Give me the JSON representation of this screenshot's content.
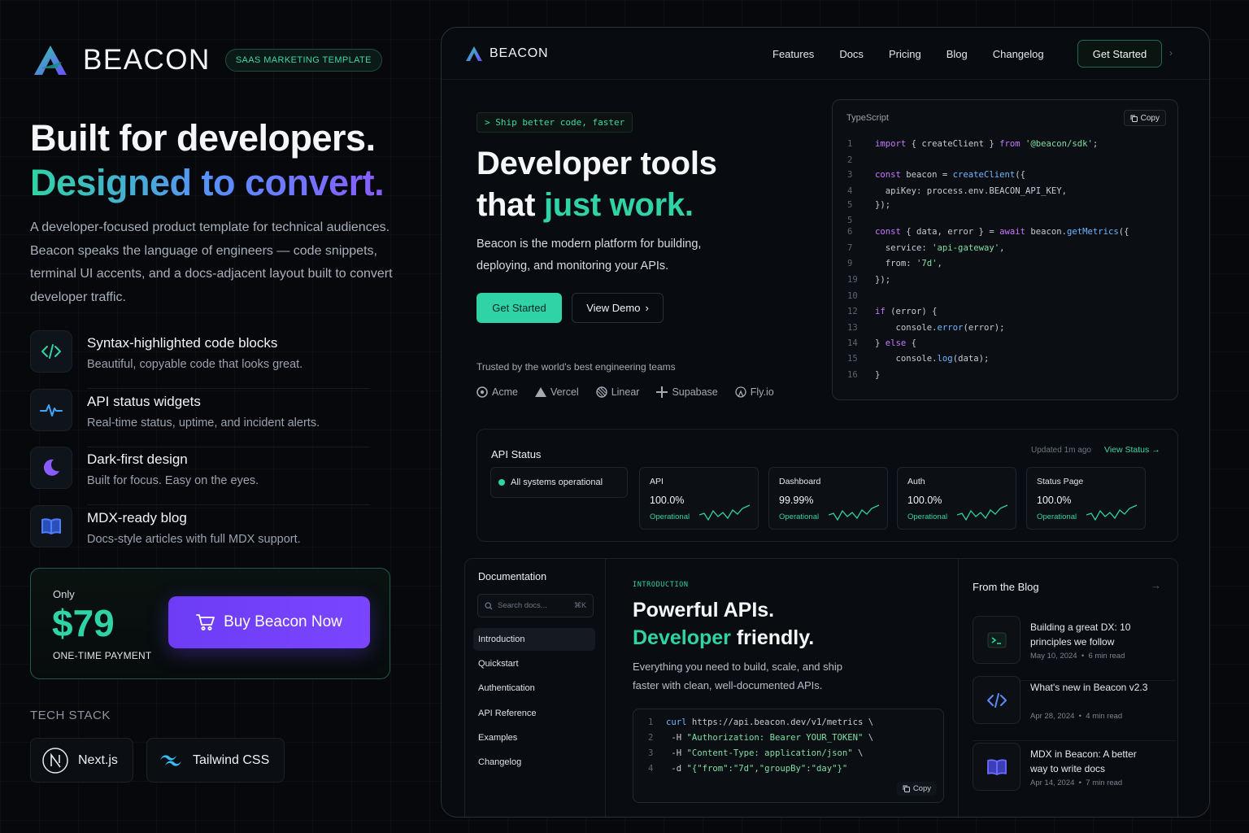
{
  "left": {
    "brand_name": "BEACON",
    "tag": "SAAS MARKETING TEMPLATE",
    "hero_line1": "Built for developers.",
    "hero_line2": "Designed to convert.",
    "lead": "A developer-focused product template for technical audiences. Beacon speaks the language of engineers — code snippets, terminal UI accents, and a docs-adjacent layout built to convert developer traffic.",
    "features": [
      {
        "title": "Syntax-highlighted code blocks",
        "desc": "Beautiful, copyable code that looks great.",
        "icon": "code-icon"
      },
      {
        "title": "API status widgets",
        "desc": "Real-time status, uptime, and incident alerts.",
        "icon": "pulse-icon"
      },
      {
        "title": "Dark-first design",
        "desc": "Built for focus. Easy on the eyes.",
        "icon": "moon-icon"
      },
      {
        "title": "MDX-ready blog",
        "desc": "Docs-style articles with full MDX support.",
        "icon": "book-icon"
      }
    ],
    "pricing": {
      "only": "Only",
      "price": "$79",
      "once": "ONE-TIME PAYMENT",
      "buy_label": "Buy Beacon Now"
    },
    "tech_label": "TECH STACK",
    "tech": [
      {
        "name": "Next.js",
        "icon": "nextjs-icon"
      },
      {
        "name": "Tailwind CSS",
        "icon": "tailwind-icon"
      }
    ]
  },
  "site": {
    "nav": {
      "brand": "BEACON",
      "links": [
        "Features",
        "Docs",
        "Pricing",
        "Blog",
        "Changelog"
      ],
      "cta": "Get Started"
    },
    "hero": {
      "kicker": "> Ship better code, faster",
      "title_line1": "Developer tools",
      "title_line2a": "that ",
      "title_line2b": "just work.",
      "sub": "Beacon is the modern platform for building, deploying, and monitoring your APIs.",
      "primary": "Get Started",
      "secondary": "View Demo",
      "trusted": "Trusted by the world's best engineering teams",
      "logos": [
        "Acme",
        "Vercel",
        "Linear",
        "Supabase",
        "Fly.io"
      ]
    },
    "code": {
      "lang": "TypeScript",
      "copy": "Copy",
      "lines": [
        {
          "n": "1",
          "html": "<span class='kw'>import</span> { createClient } <span class='kw'>from</span> <span class='str'>'@beacon/sdk'</span>;"
        },
        {
          "n": "2",
          "html": ""
        },
        {
          "n": "3",
          "html": "<span class='kw'>const</span> beacon = <span class='fn'>createClient</span>({"
        },
        {
          "n": "4",
          "html": "  apiKey: process.env.BEACON_API_KEY,"
        },
        {
          "n": "5",
          "html": "});"
        },
        {
          "n": "5",
          "html": ""
        },
        {
          "n": "6",
          "html": "<span class='kw'>const</span> { data, error } = <span class='kw'>await</span> beacon.<span class='fn'>getMetrics</span>({"
        },
        {
          "n": "7",
          "html": "  service: <span class='str'>'api-gateway'</span>,"
        },
        {
          "n": "9",
          "html": "  from: <span class='str'>'7d'</span>,"
        },
        {
          "n": "19",
          "html": "});"
        },
        {
          "n": "10",
          "html": ""
        },
        {
          "n": "12",
          "html": "<span class='kw'>if</span> (error) {"
        },
        {
          "n": "13",
          "html": "    console.<span class='fn'>error</span>(error);"
        },
        {
          "n": "14",
          "html": "} <span class='kw'>else</span> {"
        },
        {
          "n": "15",
          "html": "    console.<span class='fn'>log</span>(data);"
        },
        {
          "n": "16",
          "html": "}"
        }
      ]
    },
    "status": {
      "title": "API Status",
      "updated": "Updated 1m ago",
      "view": "View Status",
      "all": "All systems operational",
      "cards": [
        {
          "name": "API",
          "pct": "100.0%",
          "state": "Operational"
        },
        {
          "name": "Dashboard",
          "pct": "99.99%",
          "state": "Operational"
        },
        {
          "name": "Auth",
          "pct": "100.0%",
          "state": "Operational"
        },
        {
          "name": "Status Page",
          "pct": "100.0%",
          "state": "Operational"
        }
      ]
    },
    "docs": {
      "heading": "Documentation",
      "search_placeholder": "Search docs...",
      "search_kbd": "⌘K",
      "items": [
        "Introduction",
        "Quickstart",
        "Authentication",
        "API Reference",
        "Examples",
        "Changelog"
      ],
      "intro": "INTRODUCTION",
      "title1": "Powerful APIs.",
      "title2a": "Developer",
      "title2b": " friendly.",
      "para": "Everything you need to build, scale, and ship faster with clean, well-documented APIs.",
      "curl": [
        {
          "n": "1",
          "html": "<span class='fn'>curl</span> https://api.beacon.dev/v1/metrics \\"
        },
        {
          "n": "2",
          "html": " -H <span class='str'>\"Authorization: Bearer YOUR_TOKEN\"</span> \\"
        },
        {
          "n": "3",
          "html": " -H <span class='str'>\"Content-Type: application/json\"</span> \\"
        },
        {
          "n": "4",
          "html": " -d <span class='str'>\"{\"from\":\"7d\",\"groupBy\":\"day\"}\"</span>"
        }
      ],
      "copy": "Copy"
    },
    "blog": {
      "heading": "From the Blog",
      "posts": [
        {
          "title": "Building a great DX: 10 principles we follow",
          "date": "May 10, 2024",
          "read": "6 min read",
          "icon": "terminal-icon"
        },
        {
          "title": "What's new in Beacon v2.3",
          "date": "Apr 28, 2024",
          "read": "4 min read",
          "icon": "code-icon"
        },
        {
          "title": "MDX in Beacon: A better way to write docs",
          "date": "Apr 14, 2024",
          "read": "7 min read",
          "icon": "book-icon"
        }
      ]
    }
  }
}
